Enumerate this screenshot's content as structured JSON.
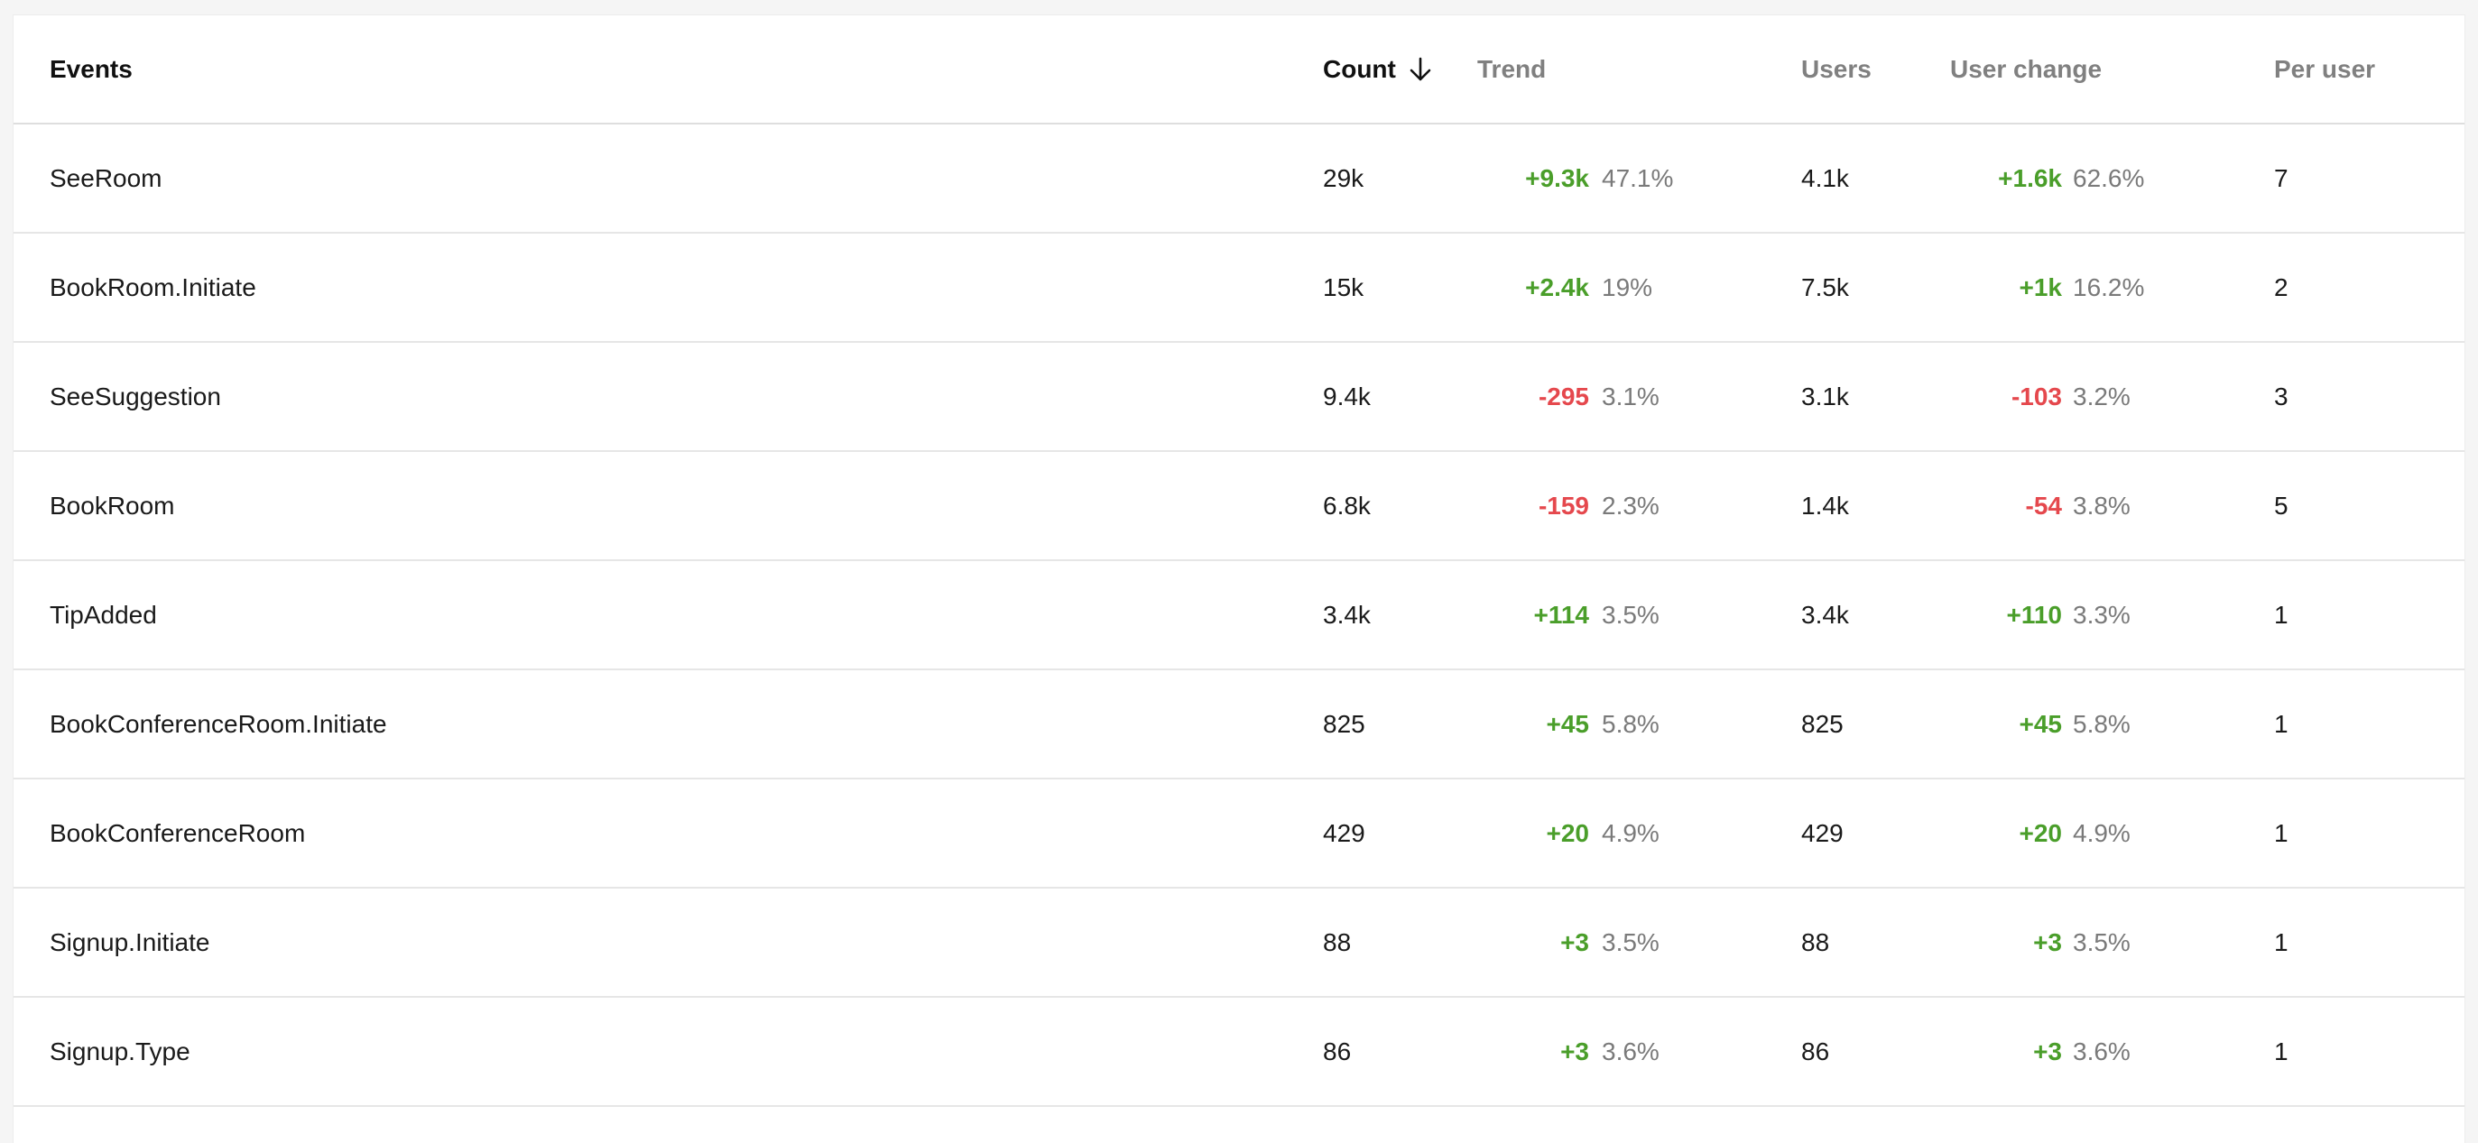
{
  "colors": {
    "positive": "#4a9e2a",
    "negative": "#e5484d",
    "muted": "#7a7a7a"
  },
  "header": {
    "events": "Events",
    "count": "Count",
    "trend": "Trend",
    "users": "Users",
    "user_change": "User change",
    "per_user": "Per user",
    "sort_icon": "arrow-down-icon"
  },
  "rows": [
    {
      "event": "SeeRoom",
      "count": "29k",
      "trend_delta": "+9.3k",
      "trend_dir": "up",
      "trend_pct": "47.1%",
      "users": "4.1k",
      "uchg_delta": "+1.6k",
      "uchg_dir": "up",
      "uchg_pct": "62.6%",
      "per_user": "7"
    },
    {
      "event": "BookRoom.Initiate",
      "count": "15k",
      "trend_delta": "+2.4k",
      "trend_dir": "up",
      "trend_pct": "19%",
      "users": "7.5k",
      "uchg_delta": "+1k",
      "uchg_dir": "up",
      "uchg_pct": "16.2%",
      "per_user": "2"
    },
    {
      "event": "SeeSuggestion",
      "count": "9.4k",
      "trend_delta": "-295",
      "trend_dir": "down",
      "trend_pct": "3.1%",
      "users": "3.1k",
      "uchg_delta": "-103",
      "uchg_dir": "down",
      "uchg_pct": "3.2%",
      "per_user": "3"
    },
    {
      "event": "BookRoom",
      "count": "6.8k",
      "trend_delta": "-159",
      "trend_dir": "down",
      "trend_pct": "2.3%",
      "users": "1.4k",
      "uchg_delta": "-54",
      "uchg_dir": "down",
      "uchg_pct": "3.8%",
      "per_user": "5"
    },
    {
      "event": "TipAdded",
      "count": "3.4k",
      "trend_delta": "+114",
      "trend_dir": "up",
      "trend_pct": "3.5%",
      "users": "3.4k",
      "uchg_delta": "+110",
      "uchg_dir": "up",
      "uchg_pct": "3.3%",
      "per_user": "1"
    },
    {
      "event": "BookConferenceRoom.Initiate",
      "count": "825",
      "trend_delta": "+45",
      "trend_dir": "up",
      "trend_pct": "5.8%",
      "users": "825",
      "uchg_delta": "+45",
      "uchg_dir": "up",
      "uchg_pct": "5.8%",
      "per_user": "1"
    },
    {
      "event": "BookConferenceRoom",
      "count": "429",
      "trend_delta": "+20",
      "trend_dir": "up",
      "trend_pct": "4.9%",
      "users": "429",
      "uchg_delta": "+20",
      "uchg_dir": "up",
      "uchg_pct": "4.9%",
      "per_user": "1"
    },
    {
      "event": "Signup.Initiate",
      "count": "88",
      "trend_delta": "+3",
      "trend_dir": "up",
      "trend_pct": "3.5%",
      "users": "88",
      "uchg_delta": "+3",
      "uchg_dir": "up",
      "uchg_pct": "3.5%",
      "per_user": "1"
    },
    {
      "event": "Signup.Type",
      "count": "86",
      "trend_delta": "+3",
      "trend_dir": "up",
      "trend_pct": "3.6%",
      "users": "86",
      "uchg_delta": "+3",
      "uchg_dir": "up",
      "uchg_pct": "3.6%",
      "per_user": "1"
    }
  ]
}
